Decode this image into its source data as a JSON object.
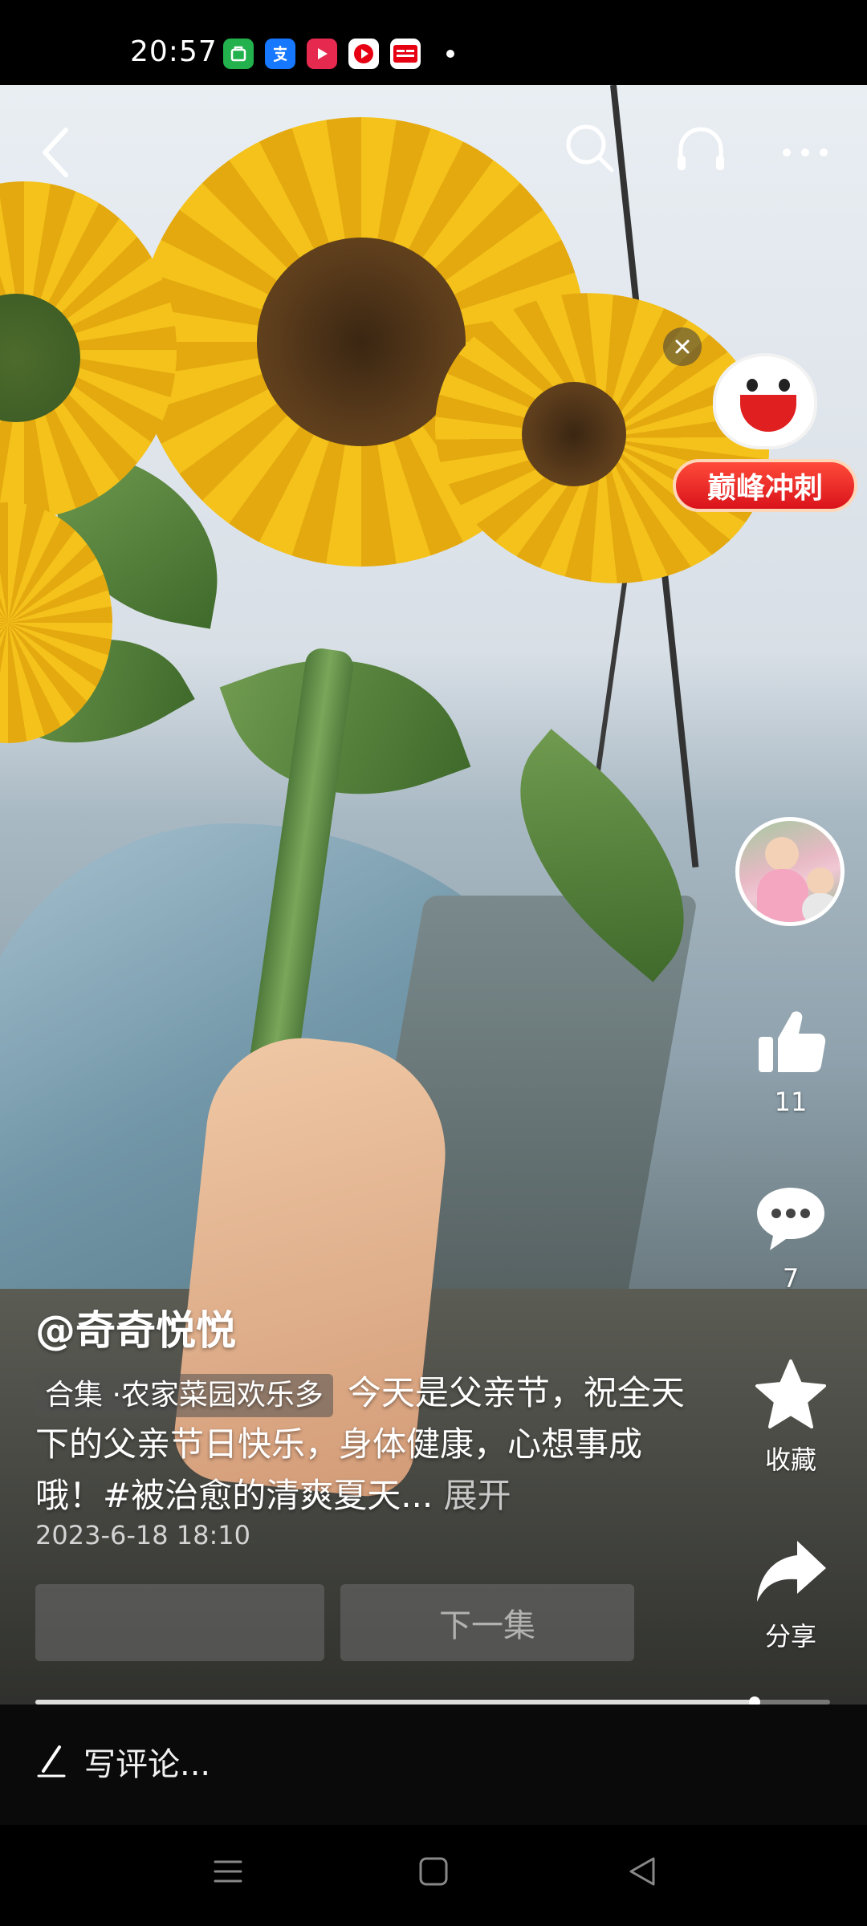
{
  "status_bar": {
    "time": "20:57",
    "app_icons": [
      {
        "name": "app-green-icon",
        "color": "#22b14c",
        "glyph": "⌘"
      },
      {
        "name": "alipay-icon",
        "color": "#1677ff",
        "glyph": "支"
      },
      {
        "name": "video-red-icon",
        "color": "#e5294f",
        "glyph": "▶"
      },
      {
        "name": "video-play-icon",
        "color": "#ffffff",
        "glyph": "●"
      },
      {
        "name": "toutiao-icon",
        "color": "#e60012",
        "glyph": "头条"
      }
    ]
  },
  "video_top": {
    "back_icon": "back-chevron",
    "search_icon": "search",
    "headphone_icon": "headphone",
    "more_icon": "more-dots"
  },
  "promo": {
    "label": "巅峰冲刺"
  },
  "actions": {
    "like_count": "11",
    "comment_count": "7",
    "favorite_label": "收藏",
    "share_label": "分享"
  },
  "post": {
    "author": "@奇奇悦悦",
    "collection_tag": "合集 ·农家菜园欢乐多",
    "description": "今天是父亲节，祝全天下的父亲节日快乐，身体健康，心想事成哦！#被治愈的清爽夏天...",
    "expand_label": "展开",
    "time": "2023-6-18 18:10"
  },
  "episodes": {
    "prev_label": "",
    "next_label": "下一集"
  },
  "progress": {
    "fraction": 0.905
  },
  "comment_bar": {
    "placeholder": "写评论..."
  },
  "nav_bar": {
    "menu_icon": "menu",
    "home_icon": "home-square",
    "back_icon": "back-triangle"
  }
}
